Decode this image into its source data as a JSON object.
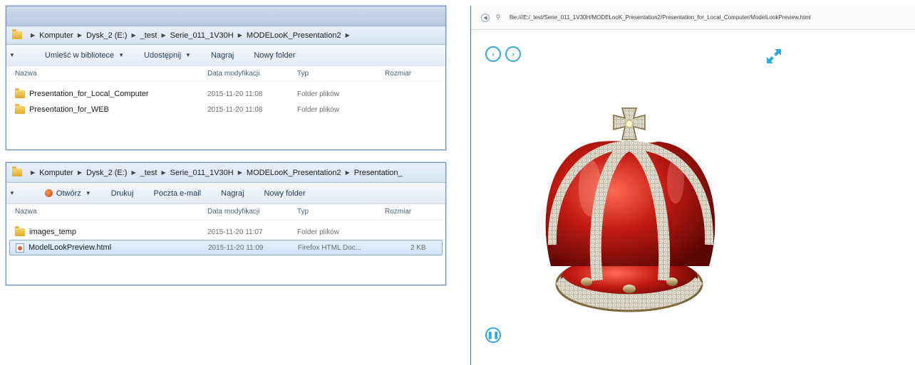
{
  "explorer_top": {
    "breadcrumb": [
      "Komputer",
      "Dysk_2 (E:)",
      "_test",
      "Serie_011_1V30H",
      "MODELooK_Presentation2"
    ],
    "toolbar": [
      "Umieść w bibliotece",
      "Udostępnij",
      "Nagraj",
      "Nowy folder"
    ],
    "columns": {
      "name": "Nazwa",
      "date": "Data modyfikacji",
      "type": "Typ",
      "size": "Rozmiar"
    },
    "rows": [
      {
        "name": "Presentation_for_Local_Computer",
        "date": "2015-11-20 11:08",
        "type": "Folder plików",
        "size": ""
      },
      {
        "name": "Presentation_for_WEB",
        "date": "2015-11-20 11:08",
        "type": "Folder plików",
        "size": ""
      }
    ]
  },
  "explorer_bottom": {
    "breadcrumb": [
      "Komputer",
      "Dysk_2 (E:)",
      "_test",
      "Serie_011_1V30H",
      "MODELooK_Presentation2",
      "Presentation_"
    ],
    "toolbar": [
      "Otwórz",
      "Drukuj",
      "Poczta e-mail",
      "Nagraj",
      "Nowy folder"
    ],
    "columns": {
      "name": "Nazwa",
      "date": "Data modyfikacji",
      "type": "Typ",
      "size": "Rozmiar"
    },
    "rows": [
      {
        "name": "images_temp",
        "date": "2015-11-20 11:07",
        "type": "Folder plików",
        "size": ""
      },
      {
        "name": "ModelLookPreview.html",
        "date": "2015-11-20 11:09",
        "type": "Firefox HTML Doc...",
        "size": "2 KB"
      }
    ]
  },
  "browser": {
    "url": "file:///E:/_test/Serie_011_1V30H/MODELooK_Presentation2/Presentation_for_Local_Computer/ModelLookPreview.html",
    "accent_color": "#2fa9e0",
    "icons": [
      "prev-icon",
      "next-icon",
      "fullscreen-icon",
      "pause-icon"
    ]
  }
}
